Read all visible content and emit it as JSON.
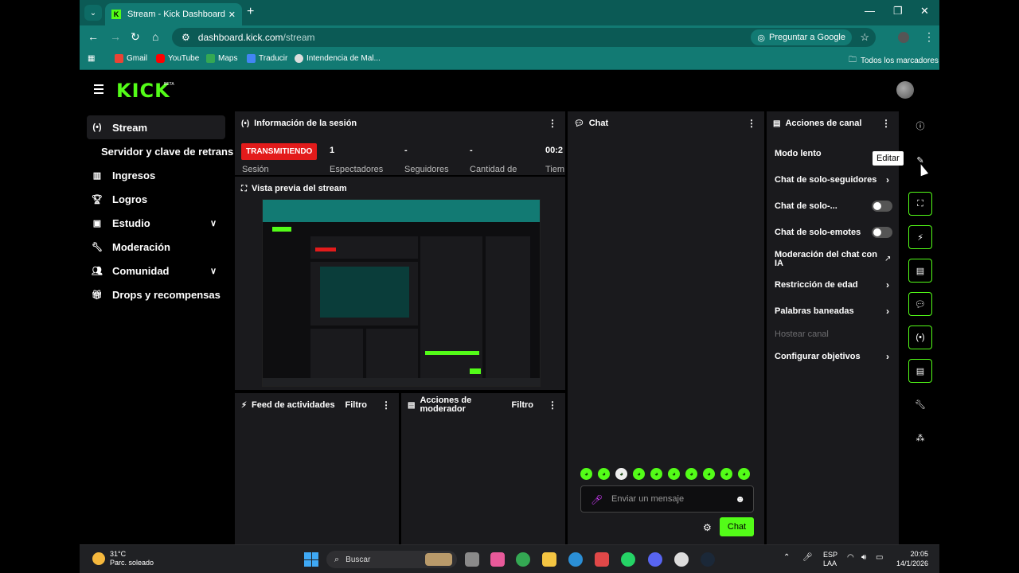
{
  "browser": {
    "tab_title": "Stream - Kick Dashboard",
    "url_host": "dashboard.kick.com",
    "url_path": "/stream",
    "ask_google": "Preguntar a Google",
    "bookmarks": [
      "Gmail",
      "YouTube",
      "Maps",
      "Traducir",
      "Intendencia de Mal..."
    ],
    "all_bookmarks": "Todos los marcadores",
    "icons": [
      "tab-list-icon",
      "new-tab-icon",
      "minimize-icon",
      "maximize-icon",
      "close-icon",
      "back-icon",
      "forward-icon",
      "reload-icon",
      "home-icon",
      "site-info-icon",
      "star-icon",
      "profile-icon",
      "menu-icon",
      "apps-icon",
      "folder-icon"
    ]
  },
  "kick": {
    "logo": "KICK",
    "beta": "BETA"
  },
  "sidebar": {
    "items": [
      {
        "label": "Stream",
        "icon": "broadcast-icon",
        "active": true
      },
      {
        "label": "Servidor y clave de retransm",
        "icon": "",
        "sub": true
      },
      {
        "label": "Ingresos",
        "icon": "chart-icon"
      },
      {
        "label": "Logros",
        "icon": "trophy-icon"
      },
      {
        "label": "Estudio",
        "icon": "studio-icon",
        "expandable": true
      },
      {
        "label": "Moderación",
        "icon": "wrench-icon"
      },
      {
        "label": "Comunidad",
        "icon": "community-icon",
        "expandable": true
      },
      {
        "label": "Drops y recompensas",
        "icon": "gift-icon"
      }
    ]
  },
  "session": {
    "title": "Información de la sesión",
    "status": "TRANSMITIENDO",
    "stats": [
      {
        "value": "1",
        "label": "Espectadores"
      },
      {
        "value": "-",
        "label": "Seguidores"
      },
      {
        "value": "-",
        "label": "Cantidad de"
      },
      {
        "value": "00:2",
        "label": "Tiem"
      }
    ],
    "session_label": "Sesión"
  },
  "preview": {
    "title": "Vista previa del stream"
  },
  "feed": {
    "title": "Feed de actividades",
    "filter": "Filtro"
  },
  "mod_actions": {
    "title": "Acciones de moderador",
    "filter": "Filtro"
  },
  "chat": {
    "title": "Chat",
    "placeholder": "Enviar un mensaje",
    "send": "Chat",
    "emote_count": 10
  },
  "channel_actions": {
    "title": "Acciones de canal",
    "rows": [
      {
        "label": "Modo lento",
        "control": "none"
      },
      {
        "label": "Chat de solo-seguidores",
        "control": "arrow"
      },
      {
        "label": "Chat de solo-...",
        "control": "toggle",
        "on": false
      },
      {
        "label": "Chat de solo-emotes",
        "control": "toggle",
        "on": false
      },
      {
        "label": "Moderación del chat con IA",
        "control": "external"
      },
      {
        "label": "Restricción de edad",
        "control": "arrow"
      },
      {
        "label": "Palabras baneadas",
        "control": "arrow"
      },
      {
        "label": "Hostear canal",
        "control": "none",
        "disabled": true
      },
      {
        "label": "Configurar objetivos",
        "control": "arrow"
      }
    ]
  },
  "rail": {
    "tooltip": "Editar",
    "buttons": [
      "info-icon",
      "edit-icon",
      "preview-icon",
      "bolt-icon",
      "document-icon",
      "chat-icon",
      "broadcast-icon",
      "channel-actions-icon",
      "wrench-icon",
      "share-icon"
    ]
  },
  "taskbar": {
    "temp": "31°C",
    "weather": "Parc. soleado",
    "search": "Buscar",
    "lang1": "ESP",
    "lang2": "LAA",
    "time": "20:05",
    "date": "14/1/2026"
  },
  "colors": {
    "kick_green": "#53fc18",
    "live_red": "#e31b1b",
    "chrome_teal": "#127a73",
    "panel": "#1a1a1d"
  }
}
